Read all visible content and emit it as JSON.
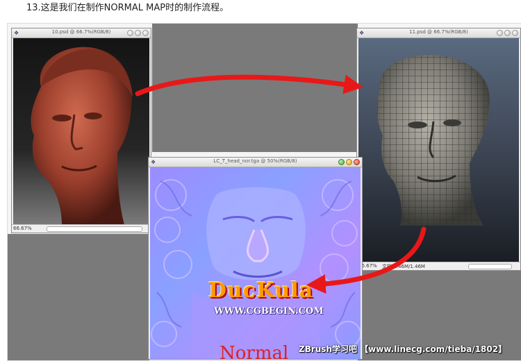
{
  "caption": "13.这是我们在制作NORMAL MAP时的制作流程。",
  "windows": {
    "psd": {
      "title": "10.psd @ 66.7%(RGB/8)",
      "zoom": "66.67%"
    },
    "mesh": {
      "title": "11.psd @ 66.7%(RGB/8)",
      "zoom": "66.67%",
      "doc_size": "文档:1.46M/1.46M"
    },
    "normal": {
      "title": "LC_T_head_nor.tga @ 50%(RGB/8)"
    }
  },
  "logo": {
    "title": "DucKula",
    "url": "WWW.CGBEGIN.COM"
  },
  "normal_text": "Normal",
  "watermark": "ZBrush学习吧 【www.linecg.com/tieba/1802】",
  "colors": {
    "arrow": "#e81818",
    "skin": "#b0503a",
    "normal_base": "#9a8cff"
  }
}
